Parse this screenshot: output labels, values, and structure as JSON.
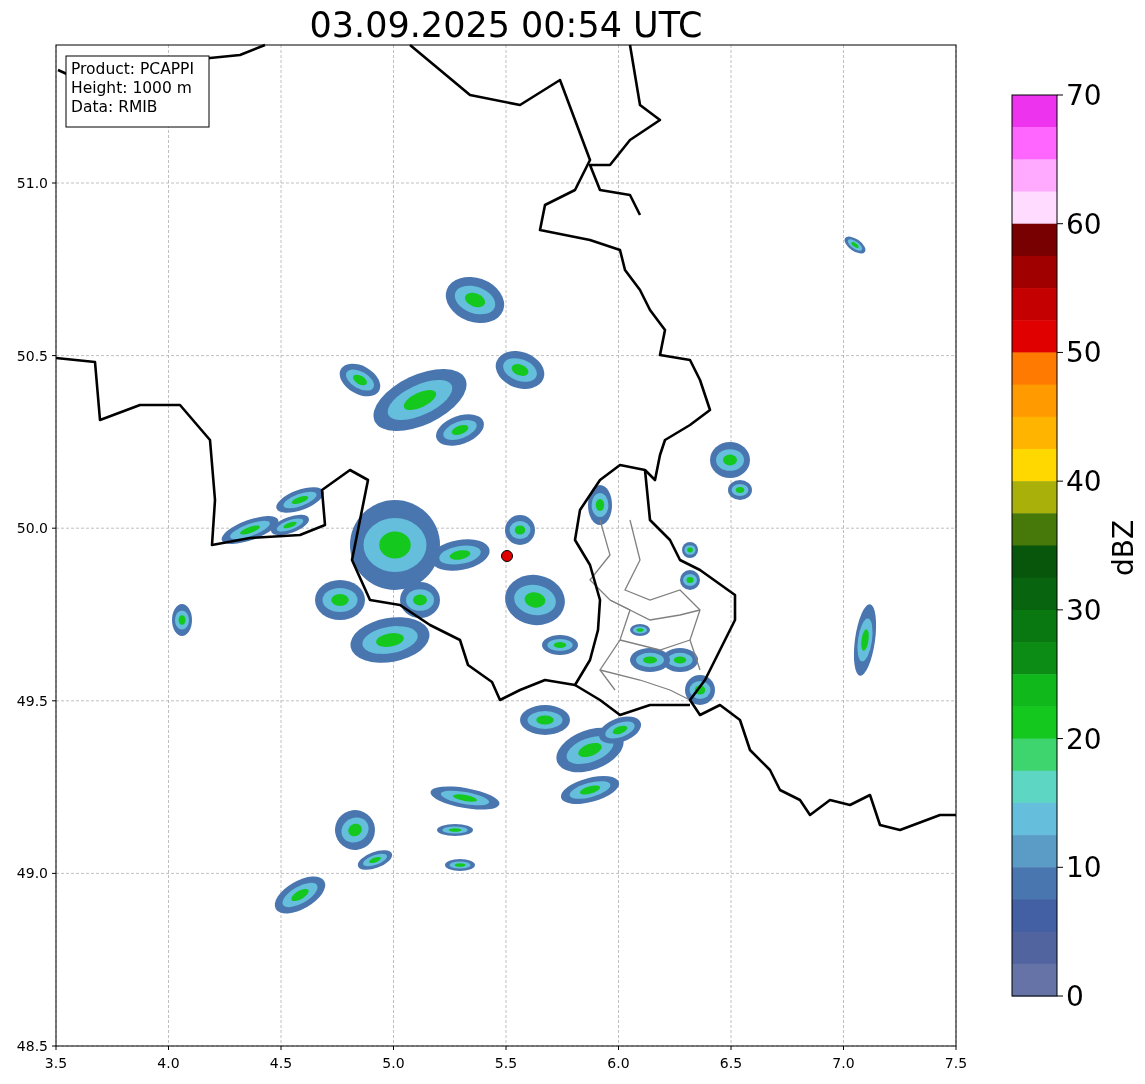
{
  "title": "03.09.2025 00:54 UTC",
  "info_box": [
    "Product: PCAPPI",
    "Height: 1000 m",
    "Data: RMIB"
  ],
  "x_ticks": [
    "3.5",
    "4.0",
    "4.5",
    "5.0",
    "5.5",
    "6.0",
    "6.5",
    "7.0",
    "7.5"
  ],
  "y_ticks": [
    "51.0",
    "50.5",
    "50.0",
    "49.5",
    "49.0",
    "48.5"
  ],
  "colorbar": {
    "label": "dBZ",
    "ticks": [
      "70",
      "60",
      "50",
      "40",
      "30",
      "20",
      "10",
      "0"
    ],
    "segments": [
      {
        "color": "#ee33ee"
      },
      {
        "color": "#ff66ff"
      },
      {
        "color": "#ffaaff"
      },
      {
        "color": "#ffdcff"
      },
      {
        "color": "#780000"
      },
      {
        "color": "#a00000"
      },
      {
        "color": "#c40000"
      },
      {
        "color": "#e00000"
      },
      {
        "color": "#ff7a00"
      },
      {
        "color": "#ff9a00"
      },
      {
        "color": "#ffb400"
      },
      {
        "color": "#ffd800"
      },
      {
        "color": "#aab00a"
      },
      {
        "color": "#46780a"
      },
      {
        "color": "#08560c"
      },
      {
        "color": "#08640e"
      },
      {
        "color": "#0a7810"
      },
      {
        "color": "#0c8c14"
      },
      {
        "color": "#10b81c"
      },
      {
        "color": "#14c81e"
      },
      {
        "color": "#3ed46e"
      },
      {
        "color": "#5ed6c4"
      },
      {
        "color": "#64bedc"
      },
      {
        "color": "#5a9cc6"
      },
      {
        "color": "#4a76b0"
      },
      {
        "color": "#4260a3"
      },
      {
        "color": "#5264a0"
      },
      {
        "color": "#6573a6"
      }
    ]
  }
}
